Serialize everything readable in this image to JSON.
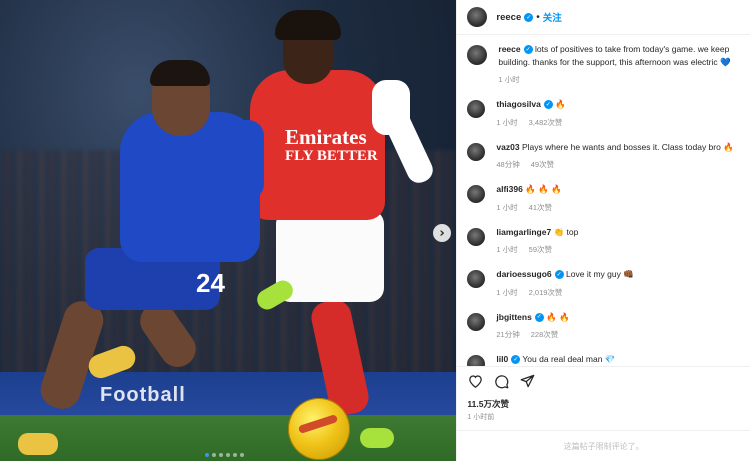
{
  "header": {
    "username": "reece",
    "follow_label": "关注",
    "separator": "•"
  },
  "caption": {
    "username": "reece",
    "text": "lots of positives to take from today's game. we keep building. thanks for the support, this afternoon was electric 💙",
    "time": "1 小时"
  },
  "comments": [
    {
      "username": "thiagosilva",
      "verified": true,
      "text": "🔥",
      "time": "1 小时",
      "likes": "3,482次赞"
    },
    {
      "username": "vaz03",
      "verified": false,
      "text": "Plays where he wants and bosses it. Class today bro 🔥",
      "time": "48分钟",
      "likes": "49次赞"
    },
    {
      "username": "alfi396",
      "verified": false,
      "text": "🔥 🔥 🔥",
      "time": "1 小时",
      "likes": "41次赞"
    },
    {
      "username": "liamgarlinge7",
      "verified": false,
      "text": "👏 top",
      "time": "1 小时",
      "likes": "59次赞"
    },
    {
      "username": "darioessugo6",
      "verified": true,
      "text": "Love it my guy 👊🏾",
      "time": "1 小时",
      "likes": "2,019次赞"
    },
    {
      "username": "jbgittens",
      "verified": true,
      "text": "🔥 🔥",
      "time": "21分钟",
      "likes": "228次赞"
    },
    {
      "username": "lil0",
      "verified": true,
      "text": "You da real deal man 💎",
      "time": "",
      "likes": ""
    }
  ],
  "post_stats": {
    "likes": "11.5万次赞",
    "time": "1 小时前"
  },
  "footer": {
    "disabled_text": "这篇帖子限制评论了。"
  },
  "media": {
    "sponsor_line1": "Emirates",
    "sponsor_line2": "FLY BETTER",
    "jersey_number": "24",
    "board_text": "Football"
  },
  "icons": [
    "heart-icon",
    "comment-icon",
    "share-icon",
    "verified-icon",
    "next-arrow-icon"
  ],
  "colors": {
    "accent": "#0095f6",
    "secondary_text": "#8e8e8e"
  }
}
